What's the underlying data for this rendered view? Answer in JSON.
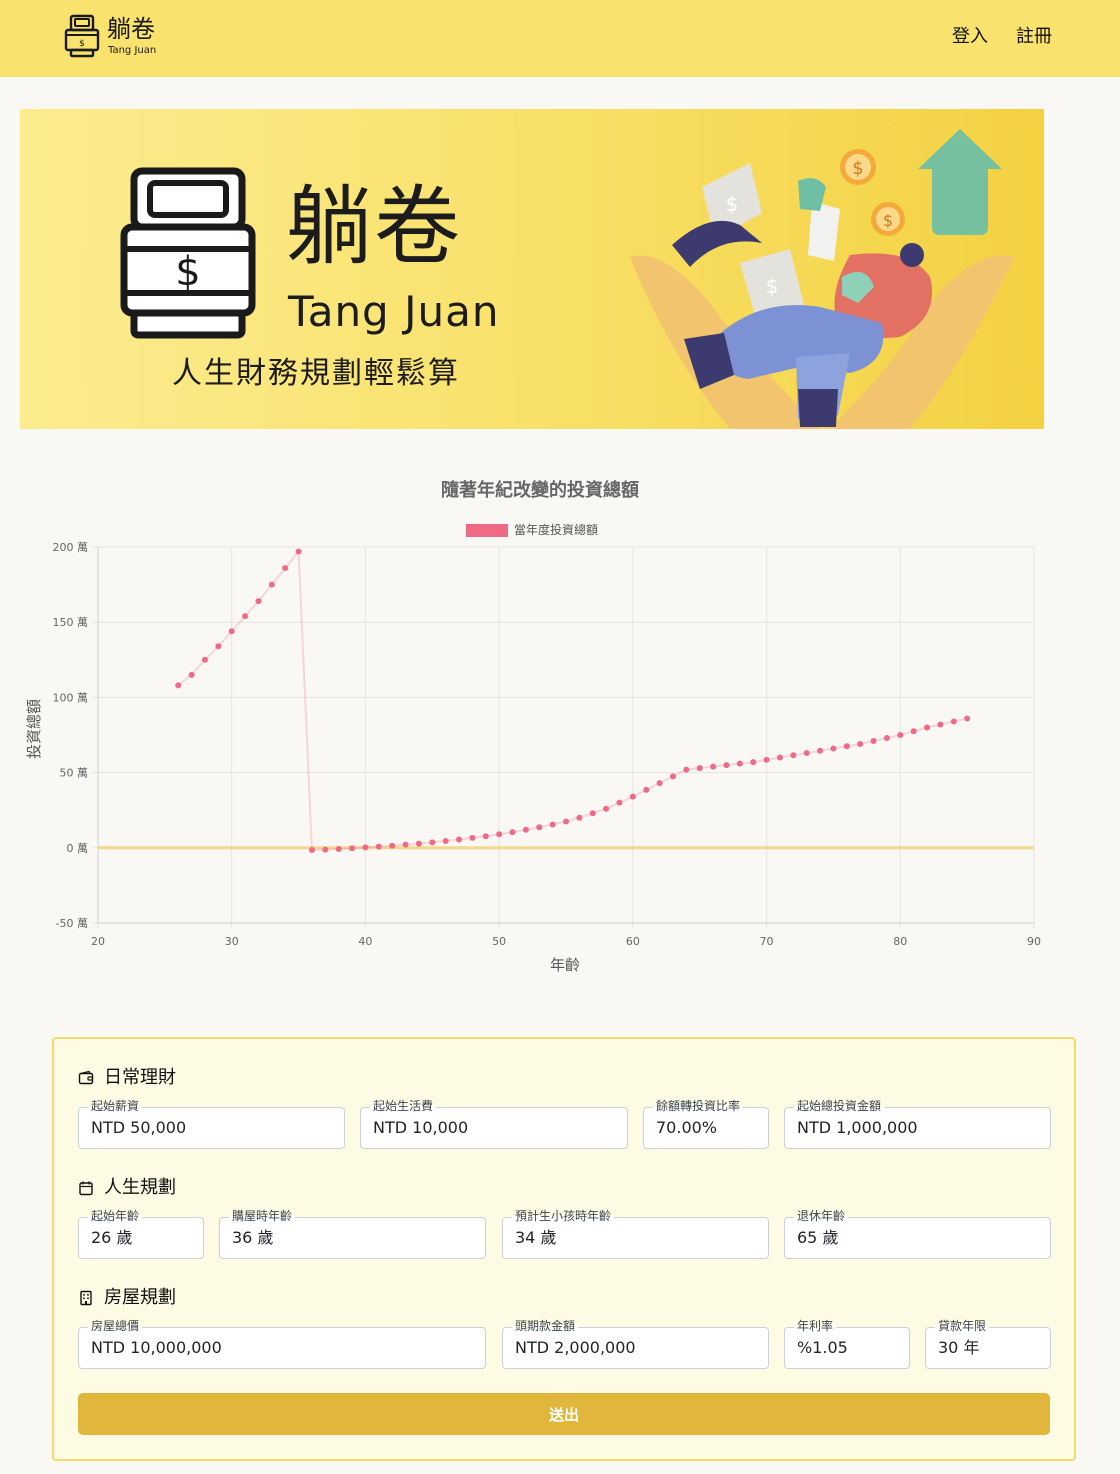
{
  "header": {
    "logo_title": "躺卷",
    "logo_subtitle": "Tang Juan",
    "nav_login": "登入",
    "nav_register": "註冊",
    "background": "#f9e26e"
  },
  "banner": {
    "title": "躺卷",
    "subtitle": "Tang Juan",
    "slogan": "人生財務規劃輕鬆算"
  },
  "chart_data": {
    "type": "line",
    "title": "隨著年紀改變的投資總額",
    "legend": "當年度投資總額",
    "legend_position": "top-center",
    "xlabel": "年齡",
    "ylabel": "投資總額",
    "xlim": [
      20,
      90
    ],
    "ylim": [
      -50,
      200
    ],
    "x_ticks": [
      "20",
      "30",
      "40",
      "50",
      "60",
      "70",
      "80",
      "90"
    ],
    "y_ticks": [
      "-50 萬",
      "0 萬",
      "50 萬",
      "100 萬",
      "150 萬",
      "200 萬"
    ],
    "grid": true,
    "series_color": "#ef6b85",
    "zero_line_color": "#f5d98a",
    "series": [
      {
        "name": "當年度投資總額",
        "x": [
          26,
          27,
          28,
          29,
          30,
          31,
          32,
          33,
          34,
          35,
          36,
          37,
          38,
          39,
          40,
          41,
          42,
          43,
          44,
          45,
          46,
          47,
          48,
          49,
          50,
          51,
          52,
          53,
          54,
          55,
          56,
          57,
          58,
          59,
          60,
          61,
          62,
          63,
          64,
          65,
          66,
          67,
          68,
          69,
          70,
          71,
          72,
          73,
          74,
          75,
          76,
          77,
          78,
          79,
          80,
          81,
          82,
          83,
          84,
          85
        ],
        "values": [
          108,
          115,
          125,
          134,
          144,
          154,
          164,
          175,
          186,
          197,
          -1.5,
          -1.2,
          -0.8,
          -0.3,
          0.3,
          0.8,
          1.4,
          2.1,
          2.8,
          3.6,
          4.5,
          5.5,
          6.6,
          7.7,
          9,
          10.4,
          12,
          13.7,
          15.5,
          17.5,
          20,
          23,
          26,
          30,
          34,
          38.5,
          43,
          47.5,
          52,
          53,
          54,
          55,
          56,
          57,
          58.5,
          60,
          61.5,
          63,
          64.5,
          66,
          67.5,
          69,
          71,
          73,
          75,
          77.5,
          80,
          82,
          84,
          86
        ]
      }
    ]
  },
  "form": {
    "sections": {
      "daily": "日常理財",
      "life": "人生規劃",
      "house": "房屋規劃"
    },
    "fields": {
      "starting_salary": {
        "label": "起始薪資",
        "value": "NTD 50,000"
      },
      "starting_living_cost": {
        "label": "起始生活費",
        "value": "NTD 10,000"
      },
      "surplus_invest_ratio": {
        "label": "餘額轉投資比率",
        "value": "70.00%"
      },
      "starting_total_investment": {
        "label": "起始總投資金額",
        "value": "NTD 1,000,000"
      },
      "starting_age": {
        "label": "起始年齡",
        "value": "26 歲"
      },
      "house_buy_age": {
        "label": "購屋時年齡",
        "value": "36 歲"
      },
      "child_age": {
        "label": "預計生小孩時年齡",
        "value": "34 歲"
      },
      "retirement_age": {
        "label": "退休年齡",
        "value": "65 歲"
      },
      "house_price": {
        "label": "房屋總價",
        "value": "NTD 10,000,000"
      },
      "down_payment": {
        "label": "頭期款金額",
        "value": "NTD 2,000,000"
      },
      "annual_rate": {
        "label": "年利率",
        "value": "%1.05"
      },
      "loan_years": {
        "label": "貸款年限",
        "value": "30 年"
      }
    },
    "submit_label": "送出",
    "accent": "#e0b73c"
  }
}
